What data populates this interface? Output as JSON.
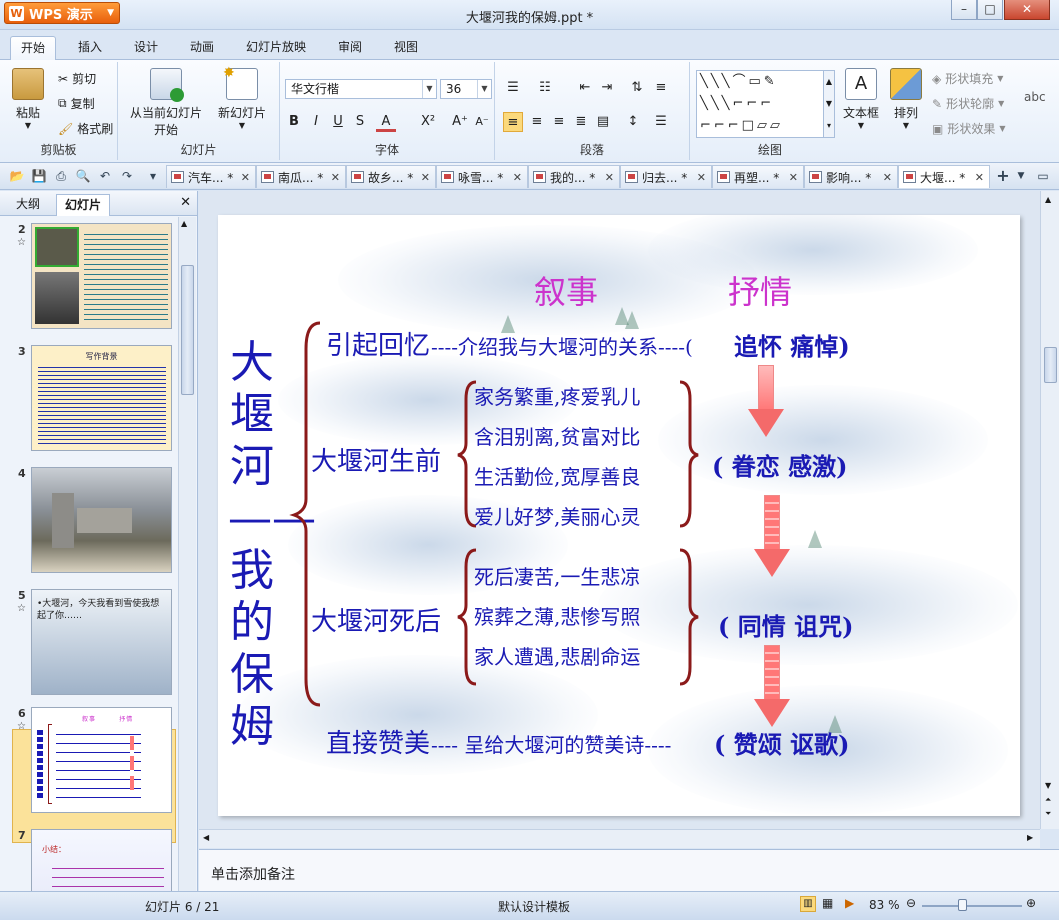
{
  "app": {
    "name": "WPS 演示",
    "doc_title": "大堰河我的保姆.ppt *"
  },
  "ribbon_tabs": [
    "开始",
    "插入",
    "设计",
    "动画",
    "幻灯片放映",
    "审阅",
    "视图"
  ],
  "ribbon": {
    "clipboard": {
      "paste": "粘贴",
      "cut": "剪切",
      "copy": "复制",
      "format_painter": "格式刷",
      "label": "剪贴板"
    },
    "slides": {
      "from_current_1": "从当前幻灯片",
      "from_current_2": "开始",
      "new_slide": "新幻灯片",
      "label": "幻灯片"
    },
    "font": {
      "name": "华文行楷",
      "size": "36",
      "label": "字体"
    },
    "paragraph": {
      "label": "段落"
    },
    "drawing": {
      "textbox": "文本框",
      "arrange": "排列",
      "shape_fill": "形状填充",
      "shape_outline": "形状轮廓",
      "shape_effect": "形状效果",
      "label": "绘图"
    }
  },
  "doc_tabs": [
    {
      "label": "汽车... *"
    },
    {
      "label": "南瓜... *"
    },
    {
      "label": "故乡... *"
    },
    {
      "label": "咏雪... *"
    },
    {
      "label": "我的... *"
    },
    {
      "label": "归去... *"
    },
    {
      "label": "再塑... *"
    },
    {
      "label": "影响... *"
    },
    {
      "label": "大堰... *"
    }
  ],
  "left_panel": {
    "tab_outline": "大纲",
    "tab_slides": "幻灯片"
  },
  "thumbnails": [
    {
      "num": "2"
    },
    {
      "num": "3",
      "title": "写作背景"
    },
    {
      "num": "4"
    },
    {
      "num": "5",
      "text": "•大堰河，今天我看到雪使我想起了你……"
    },
    {
      "num": "6"
    },
    {
      "num": "7",
      "text": "小结："
    }
  ],
  "slide": {
    "header_narrative": "叙事",
    "header_lyric": "抒情",
    "vertical_title": "大堰河——我的保姆",
    "row1_left": "引起回忆",
    "row1_mid": "----介绍我与大堰河的关系----(",
    "row1_right": "追怀  痛悼)",
    "before_label": "大堰河生前",
    "before_items": [
      "家务繁重,疼爱乳儿",
      "含泪别离,贫富对比",
      "生活勤俭,宽厚善良",
      "爱儿好梦,美丽心灵"
    ],
    "before_emotion": "(  眷恋  感激)",
    "after_label": "大堰河死后",
    "after_items": [
      "死后凄苦,一生悲凉",
      "殡葬之薄,悲惨写照",
      "家人遭遇,悲剧命运"
    ],
    "after_emotion": "( 同情  诅咒)",
    "row4_left": "直接赞美",
    "row4_mid": "---- 呈给大堰河的赞美诗----",
    "row4_right": "(  赞颂  讴歌)"
  },
  "notes_placeholder": "单击添加备注",
  "status": {
    "slide_count": "幻灯片 6 / 21",
    "template": "默认设计模板",
    "zoom": "83 %"
  },
  "colors": {
    "slide_text": "#1a1ab4",
    "header_magenta": "#cc33cc",
    "bracket": "#8b1a1a",
    "arrow": "#f46a6a"
  }
}
